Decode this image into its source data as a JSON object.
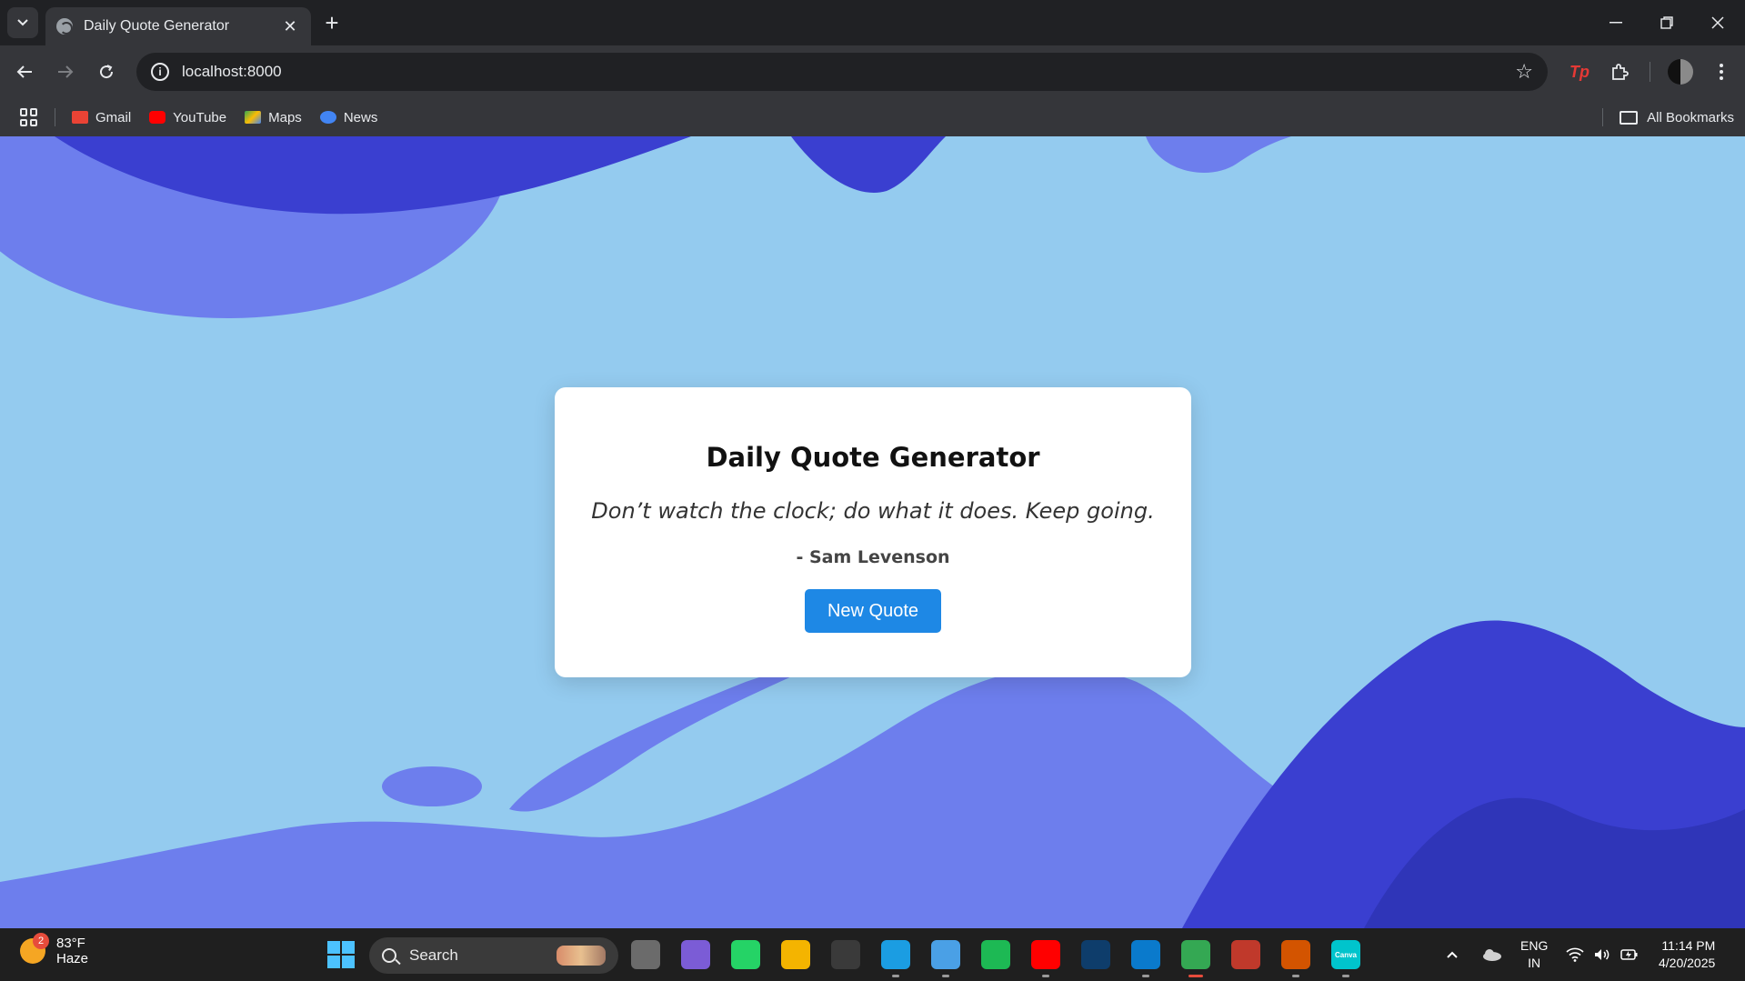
{
  "browser": {
    "tab_title": "Daily Quote Generator",
    "url": "localhost:8000",
    "bookmarks": [
      {
        "label": "Gmail",
        "color": "#ea4335"
      },
      {
        "label": "YouTube",
        "color": "#ff0000"
      },
      {
        "label": "Maps",
        "color": "#34a853"
      },
      {
        "label": "News",
        "color": "#4285f4"
      }
    ],
    "all_bookmarks": "All Bookmarks",
    "extension_label": "Tp"
  },
  "page": {
    "heading": "Daily Quote Generator",
    "quote": "Don’t watch the clock; do what it does. Keep going.",
    "author": "- Sam Levenson",
    "button": "New Quote",
    "accent": "#1e88e5",
    "background": "#94cbef"
  },
  "taskbar": {
    "weather_badge": "2",
    "temperature": "83°F",
    "condition": "Haze",
    "search_label": "Search",
    "apps": [
      {
        "name": "task-view",
        "color": "#6b6b6b",
        "glyph": "",
        "running": false
      },
      {
        "name": "copilot",
        "color": "#7b5cd6",
        "glyph": "",
        "running": false
      },
      {
        "name": "whatsapp",
        "color": "#25d366",
        "glyph": "",
        "running": false
      },
      {
        "name": "file-explorer",
        "color": "#f4b400",
        "glyph": "",
        "running": false
      },
      {
        "name": "microsoft-store",
        "color": "#3a3a3a",
        "glyph": "",
        "running": false
      },
      {
        "name": "edge",
        "color": "#1b9de2",
        "glyph": "",
        "running": true
      },
      {
        "name": "notepad",
        "color": "#4aa0e6",
        "glyph": "",
        "running": true
      },
      {
        "name": "spotify",
        "color": "#1db954",
        "glyph": "",
        "running": false
      },
      {
        "name": "youtube",
        "color": "#ff0000",
        "glyph": "",
        "running": true
      },
      {
        "name": "disney-plus",
        "color": "#0e3d6b",
        "glyph": "",
        "running": false
      },
      {
        "name": "vscode",
        "color": "#0a7acc",
        "glyph": "",
        "running": true
      },
      {
        "name": "chrome",
        "color": "#34a853",
        "glyph": "",
        "running": true,
        "active": true
      },
      {
        "name": "git-tool-1",
        "color": "#c0392b",
        "glyph": "",
        "running": false
      },
      {
        "name": "git-tool-2",
        "color": "#d35400",
        "glyph": "",
        "running": true
      },
      {
        "name": "canva",
        "color": "#00c4cc",
        "glyph": "Canva",
        "running": true
      }
    ],
    "language_top": "ENG",
    "language_bottom": "IN",
    "time": "11:14 PM",
    "date": "4/20/2025"
  }
}
